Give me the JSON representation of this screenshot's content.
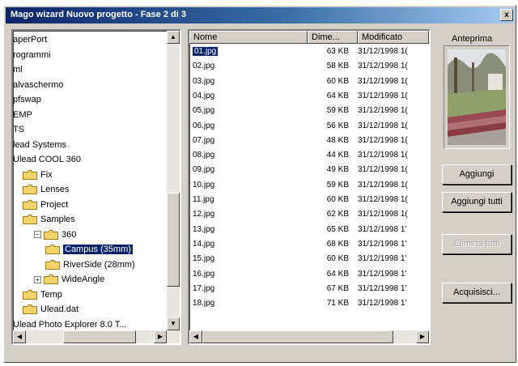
{
  "window": {
    "title": "Mago wizard Nuovo progetto - Fase 2 di 3",
    "close_label": "x"
  },
  "tree": {
    "items": [
      {
        "label": "aperPort",
        "indent": 0,
        "folder": false
      },
      {
        "label": "rogrammi",
        "indent": 0,
        "folder": false
      },
      {
        "label": "ml",
        "indent": 0,
        "folder": false
      },
      {
        "label": "alvaschermo",
        "indent": 0,
        "folder": false
      },
      {
        "label": "pfswap",
        "indent": 0,
        "folder": false
      },
      {
        "label": "EMP",
        "indent": 0,
        "folder": false
      },
      {
        "label": "TS",
        "indent": 0,
        "folder": false
      },
      {
        "label": "lead Systems",
        "indent": 0,
        "folder": false
      },
      {
        "label": "Ulead COOL 360",
        "indent": 0,
        "folder": false
      },
      {
        "label": "Fix",
        "indent": 1,
        "folder": true
      },
      {
        "label": "Lenses",
        "indent": 1,
        "folder": true
      },
      {
        "label": "Project",
        "indent": 1,
        "folder": true
      },
      {
        "label": "Samples",
        "indent": 1,
        "folder": true
      },
      {
        "label": "360",
        "indent": 2,
        "folder": true,
        "expander": "−"
      },
      {
        "label": "Campus (35mm)",
        "indent": 3,
        "folder": true,
        "selected": true
      },
      {
        "label": "RiverSide (28mm)",
        "indent": 3,
        "folder": true
      },
      {
        "label": "WideAngle",
        "indent": 2,
        "folder": true,
        "expander": "+"
      },
      {
        "label": "Temp",
        "indent": 1,
        "folder": true
      },
      {
        "label": "Ulead.dat",
        "indent": 1,
        "folder": true
      },
      {
        "label": "Ulead Photo Explorer 8.0 T...",
        "indent": 0,
        "folder": false
      }
    ]
  },
  "file_list": {
    "columns": {
      "name": "Nome",
      "size": "Dime...",
      "modified": "Modificato"
    },
    "rows": [
      {
        "name": "01.jpg",
        "size": "63 KB",
        "modified": "31/12/1998 1(",
        "selected": true
      },
      {
        "name": "02.jpg",
        "size": "58 KB",
        "modified": "31/12/1998 1("
      },
      {
        "name": "03.jpg",
        "size": "60 KB",
        "modified": "31/12/1998 1("
      },
      {
        "name": "04.jpg",
        "size": "64 KB",
        "modified": "31/12/1998 1("
      },
      {
        "name": "05.jpg",
        "size": "59 KB",
        "modified": "31/12/1998 1("
      },
      {
        "name": "06.jpg",
        "size": "56 KB",
        "modified": "31/12/1998 1("
      },
      {
        "name": "07.jpg",
        "size": "48 KB",
        "modified": "31/12/1998 1("
      },
      {
        "name": "08.jpg",
        "size": "44 KB",
        "modified": "31/12/1998 1("
      },
      {
        "name": "09.jpg",
        "size": "49 KB",
        "modified": "31/12/1998 1("
      },
      {
        "name": "10.jpg",
        "size": "59 KB",
        "modified": "31/12/1998 1("
      },
      {
        "name": "11.jpg",
        "size": "60 KB",
        "modified": "31/12/1998 1("
      },
      {
        "name": "12.jpg",
        "size": "62 KB",
        "modified": "31/12/1998 1("
      },
      {
        "name": "13.jpg",
        "size": "65 KB",
        "modified": "31/12/1998 1'"
      },
      {
        "name": "14.jpg",
        "size": "68 KB",
        "modified": "31/12/1998 1'"
      },
      {
        "name": "15.jpg",
        "size": "60 KB",
        "modified": "31/12/1998 1'"
      },
      {
        "name": "16.jpg",
        "size": "64 KB",
        "modified": "31/12/1998 1'"
      },
      {
        "name": "17.jpg",
        "size": "67 KB",
        "modified": "31/12/1998 1'"
      },
      {
        "name": "18.jpg",
        "size": "71 KB",
        "modified": "31/12/1998 1'"
      }
    ]
  },
  "preview": {
    "label": "Anteprima"
  },
  "buttons": {
    "add": "Aggiungi",
    "add_all": "Aggiungi tutti",
    "remove_all": "Elimina tutti",
    "acquire": "Acquisisci..."
  },
  "colors": {
    "title_start": "#0a246a",
    "title_end": "#a6caf0",
    "selection": "#0a246a",
    "face": "#d4d0c8"
  }
}
